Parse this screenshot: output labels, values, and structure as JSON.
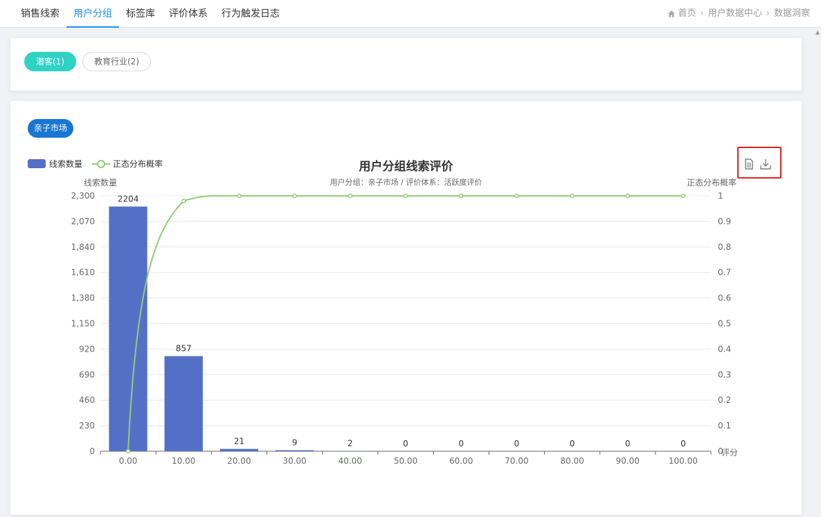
{
  "nav": {
    "tabs": [
      {
        "label": "销售线索"
      },
      {
        "label": "用户分组"
      },
      {
        "label": "标签库"
      },
      {
        "label": "评价体系"
      },
      {
        "label": "行为触发日志"
      }
    ],
    "active_tab": 1,
    "breadcrumb": [
      "首页",
      "用户数据中心",
      "数据洞察"
    ]
  },
  "filters": {
    "pills": [
      {
        "label": "潜客(1)",
        "active": true
      },
      {
        "label": "教育行业(2)",
        "active": false
      }
    ]
  },
  "group_tag": "亲子市场",
  "legend": {
    "bar_label": "线索数量",
    "line_label": "正态分布概率"
  },
  "colors": {
    "accent": "#1890ff",
    "pill_active": "#2ed3c4",
    "tag": "#1976d2",
    "bar": "#5470c6",
    "line": "#91cc75",
    "highlight": "#e02020"
  },
  "toolbox": {
    "icons": [
      "document-icon",
      "download-icon"
    ]
  },
  "chart_data": {
    "type": "bar",
    "title": "用户分组线索评价",
    "subtitle": "用户分组：亲子市场 / 评价体系：活跃度评价",
    "xlabel": "评分",
    "ylabel": "线索数量",
    "y2label": "正态分布概率",
    "categories": [
      "0.00",
      "10.00",
      "20.00",
      "30.00",
      "40.00",
      "50.00",
      "60.00",
      "70.00",
      "80.00",
      "90.00",
      "100.00"
    ],
    "ylim": [
      0,
      2300
    ],
    "y_ticks": [
      "0",
      "230",
      "460",
      "690",
      "920",
      "1,150",
      "1,380",
      "1,610",
      "1,840",
      "2,070",
      "2,300"
    ],
    "y2lim": [
      0,
      1
    ],
    "y2_ticks": [
      "0",
      "0.1",
      "0.2",
      "0.3",
      "0.4",
      "0.5",
      "0.6",
      "0.7",
      "0.8",
      "0.9",
      "1"
    ],
    "series": [
      {
        "name": "线索数量",
        "type": "bar",
        "values": [
          2204,
          857,
          21,
          9,
          2,
          0,
          0,
          0,
          0,
          0,
          0
        ]
      },
      {
        "name": "正态分布概率",
        "type": "line",
        "axis": "right",
        "values": [
          0.0,
          0.98,
          1.0,
          1.0,
          1.0,
          1.0,
          1.0,
          1.0,
          1.0,
          1.0,
          1.0
        ]
      }
    ],
    "legend_position": "top-left",
    "grid": true
  }
}
